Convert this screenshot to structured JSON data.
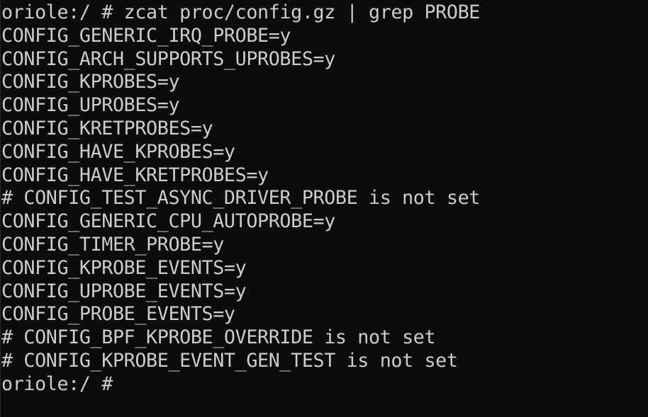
{
  "terminal": {
    "lines": [
      "oriole:/ # zcat proc/config.gz | grep PROBE",
      "CONFIG_GENERIC_IRQ_PROBE=y",
      "CONFIG_ARCH_SUPPORTS_UPROBES=y",
      "CONFIG_KPROBES=y",
      "CONFIG_UPROBES=y",
      "CONFIG_KRETPROBES=y",
      "CONFIG_HAVE_KPROBES=y",
      "CONFIG_HAVE_KRETPROBES=y",
      "# CONFIG_TEST_ASYNC_DRIVER_PROBE is not set",
      "CONFIG_GENERIC_CPU_AUTOPROBE=y",
      "CONFIG_TIMER_PROBE=y",
      "CONFIG_KPROBE_EVENTS=y",
      "CONFIG_UPROBE_EVENTS=y",
      "CONFIG_PROBE_EVENTS=y",
      "# CONFIG_BPF_KPROBE_OVERRIDE is not set",
      "# CONFIG_KPROBE_EVENT_GEN_TEST is not set",
      "oriole:/ # "
    ],
    "colors": {
      "background": "#0c0c0c",
      "text": "#cccccc"
    }
  }
}
